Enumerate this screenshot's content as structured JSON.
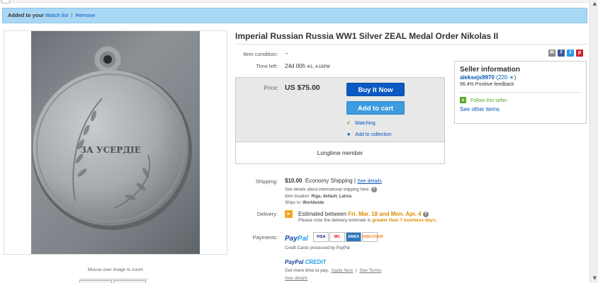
{
  "banner": {
    "prefix": "Added to your",
    "watch_list": "Watch list",
    "separator": "|",
    "remove": "Remove"
  },
  "image": {
    "medal_text": "ЗА УСЕРДІЕ",
    "mouseover": "Mouse over image to zoom"
  },
  "item": {
    "title": "Imperial Russian Russia WW1 Silver ZEAL Medal Order Nikolas II",
    "condition_label": "Item condition:",
    "condition_value": "--",
    "time_left_label": "Time left:",
    "time_left_main": "24d 00h",
    "time_left_detail": "4/1, 4:19PM"
  },
  "share": [
    "email-icon",
    "facebook-icon",
    "twitter-icon",
    "pinterest-icon"
  ],
  "buy_box": {
    "price_label": "Price:",
    "price_value": "US $75.00",
    "buy_now": "Buy It Now",
    "add_to_cart": "Add to cart",
    "watching": "Watching",
    "add_collection": "Add to collection",
    "longtime": "Longtime member"
  },
  "seller": {
    "header": "Seller information",
    "username": "aleksejs9970",
    "feedback_count_open": "(220",
    "feedback_count_close": ")",
    "positive": "96.4% Positive feedback",
    "follow": "Follow this seller",
    "see_other": "See other items"
  },
  "shipping": {
    "label": "Shipping:",
    "cost": "$10.00",
    "method": "Economy Shipping",
    "separator": "|",
    "see_details": "See details",
    "intl_note": "See details about international shipping here.",
    "location_label": "Item location:",
    "location": "Riga, default, Latvia",
    "ships_to_label": "Ships to:",
    "ships_to": "Worldwide"
  },
  "delivery": {
    "label": "Delivery:",
    "estimated": "Estimated between",
    "dates": "Fri. Mar. 18 and Mon. Apr. 4",
    "note_pre": "Please note the delivery estimate is",
    "note_warn": "greater than 7 business days."
  },
  "payments": {
    "label": "Payments:",
    "paypal_a": "Pay",
    "paypal_b": "Pal",
    "cards": [
      "VISA",
      "MC",
      "AMEX",
      "DISCOVER"
    ],
    "cc_note": "Credit Cards processed by PayPal",
    "credit_a": "PayPal",
    "credit_b": "CREDIT",
    "more_time": "Get more time to pay.",
    "apply_now": "Apply Now",
    "separator": "|",
    "see_terms": "See Terms",
    "see_details": "See details"
  },
  "colors": {
    "banner_bg": "#a9d8f5",
    "buy_button": "#0a5ac2",
    "cart_button": "#3d9be0",
    "link": "#0654ba",
    "delivery_accent": "#dd8c00"
  }
}
